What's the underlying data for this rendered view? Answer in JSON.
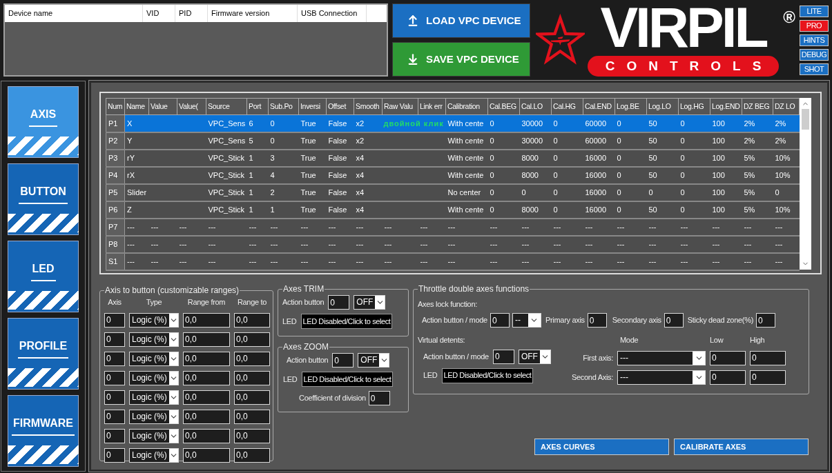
{
  "device_table": {
    "columns": [
      "Device name",
      "VID",
      "PID",
      "Firmware version",
      "USB Connection"
    ]
  },
  "device_buttons": [
    {
      "kind": "load",
      "label": "LOAD VPC DEVICE"
    },
    {
      "kind": "save",
      "label": "SAVE VPC DEVICE"
    }
  ],
  "logo": {
    "wordmark": "VIRPIL",
    "mark": "®",
    "tagline": "CONTROLS"
  },
  "modes": [
    {
      "label": "LITE",
      "selected": false
    },
    {
      "label": "PRO",
      "selected": true
    },
    {
      "label": "HINTS",
      "selected": false
    },
    {
      "label": "DEBUG",
      "selected": false
    },
    {
      "label": "SHOT",
      "selected": false
    }
  ],
  "sidebar": [
    {
      "label": "AXIS",
      "selected": true
    },
    {
      "label": "BUTTON",
      "selected": false
    },
    {
      "label": "LED",
      "selected": false
    },
    {
      "label": "PROFILE",
      "selected": false
    },
    {
      "label": "FIRMWARE",
      "selected": false
    }
  ],
  "axes_table": {
    "columns": [
      "Num",
      "Name",
      "Value",
      "Value(",
      "Source",
      "Port",
      "Sub.Po",
      "Inversi",
      "Offset",
      "Smooth",
      "Raw Valu",
      "Link err",
      "Calibration",
      "Cal.BEG",
      "Cal.LO",
      "Cal.HG",
      "Cal.END",
      "Log.BE",
      "Log.LO",
      "Log.HG",
      "Log.END",
      "DZ BEG",
      "DZ LO"
    ],
    "rows": [
      {
        "selected": true,
        "hint": "двойной клик",
        "cells": [
          "P1",
          "X",
          "",
          "",
          "VPC_Sens",
          "6",
          "0",
          "True",
          "False",
          "x2",
          "",
          "",
          "With cente",
          "0",
          "30000",
          "0",
          "60000",
          "0",
          "50",
          "0",
          "100",
          "2%",
          "2%"
        ]
      },
      {
        "selected": false,
        "cells": [
          "P2",
          "Y",
          "",
          "",
          "VPC_Sens",
          "5",
          "0",
          "True",
          "False",
          "x2",
          "",
          "",
          "With cente",
          "0",
          "30000",
          "0",
          "60000",
          "0",
          "50",
          "0",
          "100",
          "2%",
          "2%"
        ]
      },
      {
        "selected": false,
        "cells": [
          "P3",
          "rY",
          "",
          "",
          "VPC_Stick",
          "1",
          "3",
          "True",
          "False",
          "x4",
          "",
          "",
          "With cente",
          "0",
          "8000",
          "0",
          "16000",
          "0",
          "50",
          "0",
          "100",
          "5%",
          "10%"
        ]
      },
      {
        "selected": false,
        "cells": [
          "P4",
          "rX",
          "",
          "",
          "VPC_Stick",
          "1",
          "4",
          "True",
          "False",
          "x4",
          "",
          "",
          "With cente",
          "0",
          "8000",
          "0",
          "16000",
          "0",
          "50",
          "0",
          "100",
          "5%",
          "10%"
        ]
      },
      {
        "selected": false,
        "cells": [
          "P5",
          "Slider",
          "",
          "",
          "VPC_Stick",
          "1",
          "2",
          "True",
          "False",
          "x4",
          "",
          "",
          "No center",
          "0",
          "0",
          "0",
          "16000",
          "0",
          "0",
          "0",
          "100",
          "5%",
          "0"
        ]
      },
      {
        "selected": false,
        "cells": [
          "P6",
          "Z",
          "",
          "",
          "VPC_Stick",
          "1",
          "1",
          "True",
          "False",
          "x4",
          "",
          "",
          "With cente",
          "0",
          "8000",
          "0",
          "16000",
          "0",
          "50",
          "0",
          "100",
          "5%",
          "10%"
        ]
      },
      {
        "selected": false,
        "cells": [
          "P7",
          "---",
          "---",
          "---",
          "---",
          "---",
          "---",
          "---",
          "---",
          "---",
          "---",
          "---",
          "---",
          "---",
          "---",
          "---",
          "---",
          "---",
          "---",
          "---",
          "---",
          "---",
          "---"
        ]
      },
      {
        "selected": false,
        "cells": [
          "P8",
          "---",
          "---",
          "---",
          "---",
          "---",
          "---",
          "---",
          "---",
          "---",
          "---",
          "---",
          "---",
          "---",
          "---",
          "---",
          "---",
          "---",
          "---",
          "---",
          "---",
          "---",
          "---"
        ]
      },
      {
        "selected": false,
        "cells": [
          "S1",
          "---",
          "---",
          "---",
          "---",
          "---",
          "---",
          "---",
          "---",
          "---",
          "---",
          "---",
          "---",
          "---",
          "---",
          "---",
          "---",
          "---",
          "---",
          "---",
          "---",
          "---",
          "---"
        ]
      }
    ]
  },
  "axis_to_button": {
    "title": "Axis to button (customizable ranges)",
    "columns": [
      "Axis",
      "Type",
      "Range from",
      "Range to"
    ],
    "rows": [
      {
        "axis": "0",
        "type": "Logic (%)",
        "from": "0,0",
        "to": "0,0"
      },
      {
        "axis": "0",
        "type": "Logic (%)",
        "from": "0,0",
        "to": "0,0"
      },
      {
        "axis": "0",
        "type": "Logic (%)",
        "from": "0,0",
        "to": "0,0"
      },
      {
        "axis": "0",
        "type": "Logic (%)",
        "from": "0,0",
        "to": "0,0"
      },
      {
        "axis": "0",
        "type": "Logic (%)",
        "from": "0,0",
        "to": "0,0"
      },
      {
        "axis": "0",
        "type": "Logic (%)",
        "from": "0,0",
        "to": "0,0"
      },
      {
        "axis": "0",
        "type": "Logic (%)",
        "from": "0,0",
        "to": "0,0"
      },
      {
        "axis": "0",
        "type": "Logic (%)",
        "from": "0,0",
        "to": "0,0"
      }
    ]
  },
  "axes_trim": {
    "title": "Axes TRIM",
    "action_label": "Action button",
    "action_value": "0",
    "mode": "OFF",
    "led_label": "LED",
    "led_value": "LED Disabled/Click to select"
  },
  "axes_zoom": {
    "title": "Axes ZOOM",
    "action_label": "Action button",
    "action_value": "0",
    "mode": "OFF",
    "led_label": "LED",
    "led_value": "LED Disabled/Click to select",
    "coef_label": "Coefficient of division",
    "coef_value": "0"
  },
  "throttle": {
    "title": "Throttle double axes functions",
    "lock": {
      "title": "Axes lock function:",
      "action_label": "Action button / mode",
      "action_value": "0",
      "mode": "--",
      "primary_label": "Primary axis",
      "primary_value": "0",
      "secondary_label": "Secondary axis",
      "secondary_value": "0",
      "sticky_label": "Sticky dead zone(%)",
      "sticky_value": "0"
    },
    "detents": {
      "title": "Virtual detents:",
      "action_label": "Action button / mode",
      "action_value": "0",
      "mode": "OFF",
      "led_label": "LED",
      "led_value": "LED Disabled/Click to select",
      "headers": [
        "Mode",
        "Low",
        "High"
      ],
      "axes": [
        {
          "label": "First axis:",
          "mode": "---",
          "low": "0",
          "high": "0"
        },
        {
          "label": "Second Axis:",
          "mode": "---",
          "low": "0",
          "high": "0"
        }
      ]
    }
  },
  "actions": [
    "AXES CURVES",
    "CALIBRATE AXES"
  ]
}
